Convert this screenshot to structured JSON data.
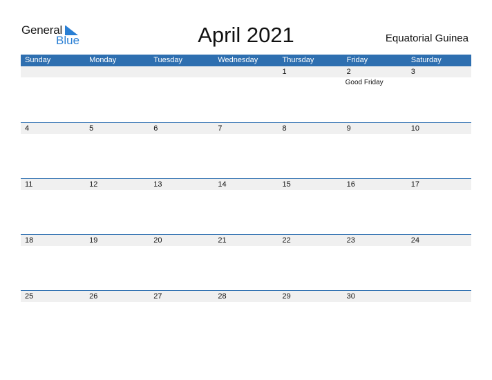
{
  "logo": {
    "word1": "General",
    "word2": "Blue",
    "icon": "triangle-flag-icon",
    "accent": "#2a7fd4"
  },
  "title": "April 2021",
  "country": "Equatorial Guinea",
  "colors": {
    "header_bg": "#2e6fb0",
    "strip_bg": "#f0f0f0"
  },
  "weekdays": [
    "Sunday",
    "Monday",
    "Tuesday",
    "Wednesday",
    "Thursday",
    "Friday",
    "Saturday"
  ],
  "weeks": [
    [
      {
        "day": ""
      },
      {
        "day": ""
      },
      {
        "day": ""
      },
      {
        "day": ""
      },
      {
        "day": "1"
      },
      {
        "day": "2",
        "holiday": "Good Friday"
      },
      {
        "day": "3"
      }
    ],
    [
      {
        "day": "4"
      },
      {
        "day": "5"
      },
      {
        "day": "6"
      },
      {
        "day": "7"
      },
      {
        "day": "8"
      },
      {
        "day": "9"
      },
      {
        "day": "10"
      }
    ],
    [
      {
        "day": "11"
      },
      {
        "day": "12"
      },
      {
        "day": "13"
      },
      {
        "day": "14"
      },
      {
        "day": "15"
      },
      {
        "day": "16"
      },
      {
        "day": "17"
      }
    ],
    [
      {
        "day": "18"
      },
      {
        "day": "19"
      },
      {
        "day": "20"
      },
      {
        "day": "21"
      },
      {
        "day": "22"
      },
      {
        "day": "23"
      },
      {
        "day": "24"
      }
    ],
    [
      {
        "day": "25"
      },
      {
        "day": "26"
      },
      {
        "day": "27"
      },
      {
        "day": "28"
      },
      {
        "day": "29"
      },
      {
        "day": "30"
      },
      {
        "day": ""
      }
    ]
  ]
}
